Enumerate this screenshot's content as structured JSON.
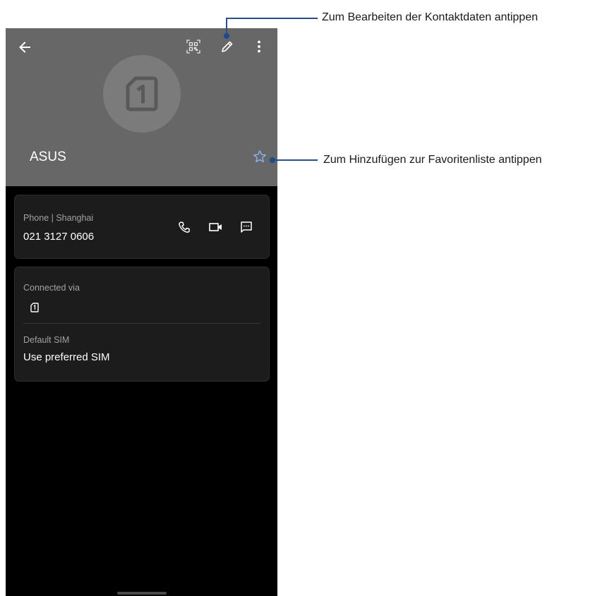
{
  "contact": {
    "name": "ASUS",
    "avatar_icon": "sim-1-icon"
  },
  "toolbar": {
    "back_icon": "arrow-left-icon",
    "qr_icon": "qr-code-icon",
    "edit_icon": "pencil-icon",
    "more_icon": "more-vert-icon",
    "favorite_icon": "star-outline-icon"
  },
  "phone_card": {
    "label": "Phone | Shanghai",
    "number": "021 3127 0606",
    "actions": [
      "phone-icon",
      "video-call-icon",
      "message-icon"
    ]
  },
  "sim_card": {
    "connected_label": "Connected via",
    "connected_icon": "sim-1-icon",
    "default_label": "Default SIM",
    "default_value": "Use preferred SIM"
  },
  "callouts": {
    "edit": "Zum Bearbeiten der Kontaktdaten antippen",
    "favorite": "Zum Hinzufügen zur Favoritenliste antippen"
  },
  "colors": {
    "header_bg": "#676767",
    "screen_bg": "#000000",
    "card_bg": "#1c1c1c",
    "star_accent": "#8ab4f8",
    "callout_line": "#2a4f8c"
  }
}
